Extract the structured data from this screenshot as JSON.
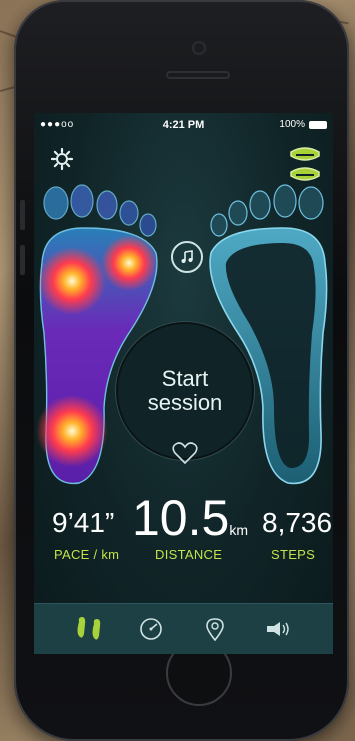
{
  "status_bar": {
    "carrier": "●●●oo",
    "time": "4:21 PM",
    "battery": "100%"
  },
  "session": {
    "line1": "Start",
    "line2": "session"
  },
  "stats": {
    "pace": {
      "value": "9’41”",
      "label": "PACE / km"
    },
    "distance": {
      "value": "10.5",
      "unit": "km",
      "label": "DISTANCE"
    },
    "steps": {
      "value": "8,736",
      "label": "STEPS"
    }
  },
  "icons": {
    "settings": "gear-icon",
    "insoles": "insoles-icon",
    "music": "music-note-icon",
    "heart": "heart-icon",
    "tabs": [
      "footprints-icon",
      "speedometer-icon",
      "location-pin-icon",
      "coach-megaphone-icon"
    ]
  },
  "colors": {
    "accent": "#c3e34a",
    "screen_bg": "#102427",
    "tabbar_bg": "#1d4045"
  }
}
